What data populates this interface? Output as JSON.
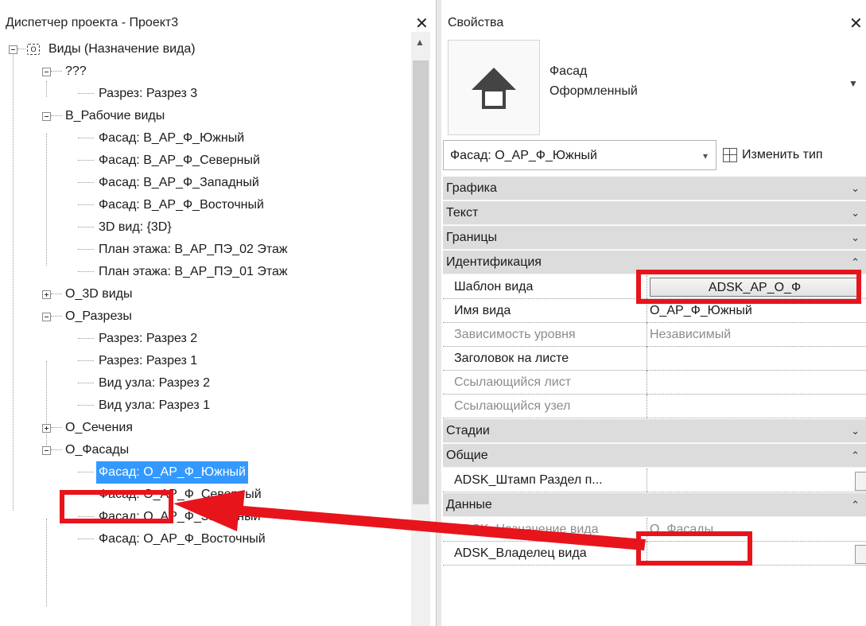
{
  "project_browser": {
    "title": "Диспетчер проекта - Проект3",
    "close_glyph": "✕",
    "root_label": "Виды (Назначение вида)",
    "nodes": [
      {
        "label": "???",
        "level": 1
      },
      {
        "label": "Разрез: Разрез 3",
        "level": 2
      },
      {
        "label": "В_Рабочие виды",
        "level": 1
      },
      {
        "label": "Фасад: В_АР_Ф_Южный",
        "level": 2
      },
      {
        "label": "Фасад: В_АР_Ф_Северный",
        "level": 2
      },
      {
        "label": "Фасад: В_АР_Ф_Западный",
        "level": 2
      },
      {
        "label": "Фасад: В_АР_Ф_Восточный",
        "level": 2
      },
      {
        "label": "3D вид: {3D}",
        "level": 2
      },
      {
        "label": "План этажа: В_АР_ПЭ_02 Этаж",
        "level": 2
      },
      {
        "label": "План этажа: В_АР_ПЭ_01 Этаж",
        "level": 2
      },
      {
        "label": "О_3D виды",
        "level": 1
      },
      {
        "label": "О_Разрезы",
        "level": 1
      },
      {
        "label": "Разрез: Разрез 2",
        "level": 2
      },
      {
        "label": "Разрез: Разрез 1",
        "level": 2
      },
      {
        "label": "Вид узла: Разрез 2",
        "level": 2
      },
      {
        "label": "Вид узла: Разрез 1",
        "level": 2
      },
      {
        "label": "О_Сечения",
        "level": 1
      },
      {
        "label": "О_Фасады",
        "level": 1
      },
      {
        "label": "Фасад: О_АР_Ф_Южный",
        "level": 2,
        "selected": true
      },
      {
        "label": "Фасад: О_АР_Ф_Северный",
        "level": 2
      },
      {
        "label": "Фасад: О_АР_Ф_Западный",
        "level": 2
      },
      {
        "label": "Фасад: О_АР_Ф_Восточный",
        "level": 2
      }
    ]
  },
  "properties": {
    "title": "Свойства",
    "close_glyph": "✕",
    "type_family": "Фасад",
    "type_name": "Оформленный",
    "instance_selector": "Фасад: О_АР_Ф_Южный",
    "edit_type_label": "Изменить тип",
    "categories": {
      "graphics": "Графика",
      "text": "Текст",
      "extents": "Границы",
      "identity": "Идентификация",
      "phasing": "Стадии",
      "general": "Общие",
      "data": "Данные"
    },
    "identity_rows": {
      "view_template": {
        "name": "Шаблон вида",
        "value": "ADSK_АР_О_Ф"
      },
      "view_name": {
        "name": "Имя вида",
        "value": "О_АР_Ф_Южный"
      },
      "dependency": {
        "name": "Зависимость уровня",
        "value": "Независимый"
      },
      "title_on_sheet": {
        "name": "Заголовок на листе",
        "value": ""
      },
      "referencing_sheet": {
        "name": "Ссылающийся лист",
        "value": ""
      },
      "referencing_detail": {
        "name": "Ссылающийся узел",
        "value": ""
      }
    },
    "general_rows": {
      "stamp_section": {
        "name": "ADSK_Штамп Раздел п...",
        "value": ""
      }
    },
    "data_rows": {
      "view_purpose": {
        "name": "ADSK_Назначение вида",
        "value": "О_Фасады"
      },
      "view_owner": {
        "name": "ADSK_Владелец вида",
        "value": ""
      }
    }
  },
  "colors": {
    "annotation_red": "#e8141c",
    "selection_blue": "#3399ff",
    "category_header": "#dcdcdc"
  }
}
